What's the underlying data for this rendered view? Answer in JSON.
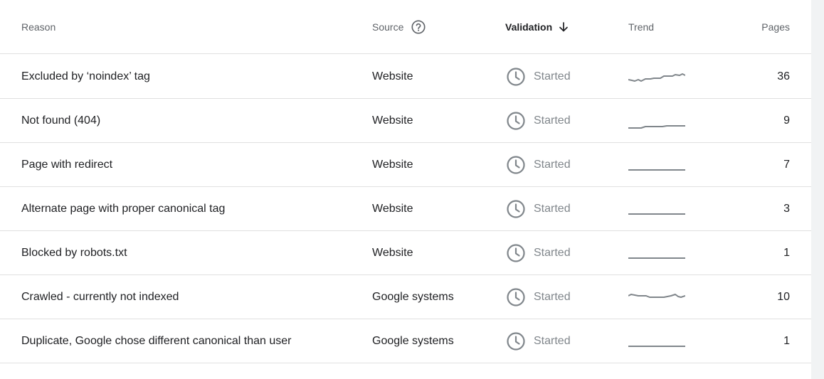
{
  "header": {
    "reason": "Reason",
    "source": "Source",
    "validation": "Validation",
    "trend": "Trend",
    "pages": "Pages"
  },
  "icons": {
    "help": "help-circle-icon",
    "sort": "arrow-down-icon",
    "status": "clock-icon"
  },
  "colors": {
    "accent_text": "#202124",
    "muted_text": "#5f6368",
    "status_gray": "#80868b",
    "divider": "#e0e0e0"
  },
  "rows": [
    {
      "reason": "Excluded by ‘noindex’ tag",
      "source": "Website",
      "validation": "Started",
      "pages": "36",
      "trend": "rising"
    },
    {
      "reason": "Not found (404)",
      "source": "Website",
      "validation": "Started",
      "pages": "9",
      "trend": "rising"
    },
    {
      "reason": "Page with redirect",
      "source": "Website",
      "validation": "Started",
      "pages": "7",
      "trend": "flat"
    },
    {
      "reason": "Alternate page with proper canonical tag",
      "source": "Website",
      "validation": "Started",
      "pages": "3",
      "trend": "flat"
    },
    {
      "reason": "Blocked by robots.txt",
      "source": "Website",
      "validation": "Started",
      "pages": "1",
      "trend": "flat"
    },
    {
      "reason": "Crawled - currently not indexed",
      "source": "Google systems",
      "validation": "Started",
      "pages": "10",
      "trend": "fluctuating"
    },
    {
      "reason": "Duplicate, Google chose different canonical than user",
      "source": "Google systems",
      "validation": "Started",
      "pages": "1",
      "trend": "flat"
    }
  ]
}
